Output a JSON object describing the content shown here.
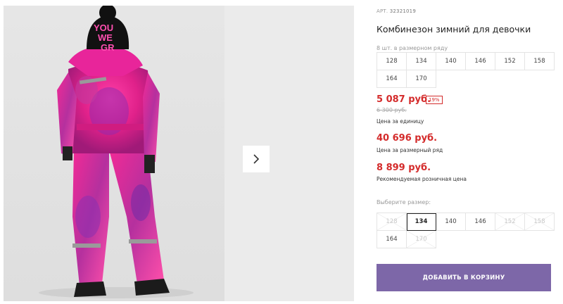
{
  "gallery": {
    "next_icon": "chevron-right-icon",
    "hat_text": "YOU WE GR"
  },
  "product": {
    "sku_label": "АРТ.",
    "sku": "32321019",
    "title": "Комбинезон зимний для девочки",
    "row_note": "8 шт. в размерном ряду",
    "size_row": [
      "128",
      "134",
      "140",
      "146",
      "152",
      "158",
      "164",
      "170"
    ]
  },
  "pricing": {
    "price": "5 087 руб.",
    "discount": "19%",
    "old_price": "6 300 руб.",
    "price_caption": "Цена за единицу",
    "row_price": "40 696 руб.",
    "row_caption": "Цена за размерный ряд",
    "retail_price": "8 899 руб.",
    "retail_caption": "Рекомендуемая розничная цена"
  },
  "size_selector": {
    "label": "Выберите размер:",
    "options": [
      {
        "label": "128",
        "available": false
      },
      {
        "label": "134",
        "available": true,
        "selected": true
      },
      {
        "label": "140",
        "available": true
      },
      {
        "label": "146",
        "available": true
      },
      {
        "label": "152",
        "available": false
      },
      {
        "label": "158",
        "available": false
      },
      {
        "label": "164",
        "available": true
      },
      {
        "label": "170",
        "available": false
      }
    ]
  },
  "cart": {
    "add_label": "ДОБАВИТЬ В КОРЗИНУ"
  },
  "colors": {
    "price_red": "#d42b2b",
    "button_purple": "#7d67a8"
  }
}
